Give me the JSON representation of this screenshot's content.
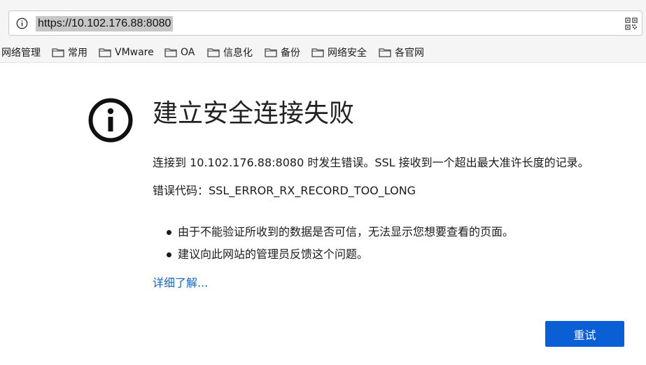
{
  "address_bar": {
    "url": "https://10.102.176.88:8080",
    "info_icon": "info-icon",
    "qr_icon": "qr-code-icon"
  },
  "bookmarks": [
    {
      "label": "网络管理",
      "folder": false
    },
    {
      "label": "常用",
      "folder": true
    },
    {
      "label": "VMware",
      "folder": true
    },
    {
      "label": "OA",
      "folder": true
    },
    {
      "label": "信息化",
      "folder": true
    },
    {
      "label": "备份",
      "folder": true
    },
    {
      "label": "网络安全",
      "folder": true
    },
    {
      "label": "各官网",
      "folder": true
    }
  ],
  "error_page": {
    "icon": "info-circle-icon",
    "title": "建立安全连接失败",
    "description": "连接到 10.102.176.88:8080 时发生错误。SSL 接收到一个超出最大准许长度的记录。",
    "error_code_line": "错误代码：SSL_ERROR_RX_RECORD_TOO_LONG",
    "bullets": [
      "由于不能验证所收到的数据是否可信，无法显示您想要查看的页面。",
      "建议向此网站的管理员反馈这个问题。"
    ],
    "learn_more": "详细了解...",
    "retry_button": "重试"
  },
  "colors": {
    "accent": "#0a5fd4",
    "link": "#1565c0",
    "chrome_bg": "#f5f5f6"
  }
}
